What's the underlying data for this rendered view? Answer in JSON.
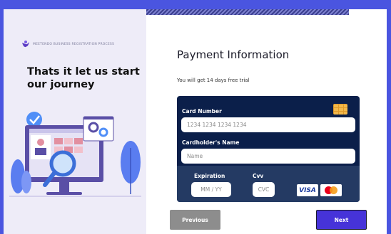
{
  "brand": {
    "name": "MEETENDO BUSINESS REGISTRATION PROCESS"
  },
  "headline": "Thats it let us start our journey",
  "payment": {
    "title": "Payment Information",
    "subtitle": "You will get 14 days free trial"
  },
  "card": {
    "number_label": "Card Number",
    "number_placeholder": "1234 1234 1234 1234",
    "holder_label": "Cardholder's Name",
    "holder_placeholder": "Name",
    "expiration_label": "Expiration",
    "expiration_placeholder": "MM / YY",
    "cvv_label": "Cvv",
    "cvv_placeholder": "CVC",
    "visa_text": "VISA"
  },
  "buttons": {
    "previous": "Previous",
    "next": "Next"
  },
  "colors": {
    "background": "#4a55e0",
    "card_dark": "#0b1f4a",
    "card_bottom": "#243a63",
    "next_button": "#4633d9",
    "previous_button": "#8d8d8d"
  }
}
